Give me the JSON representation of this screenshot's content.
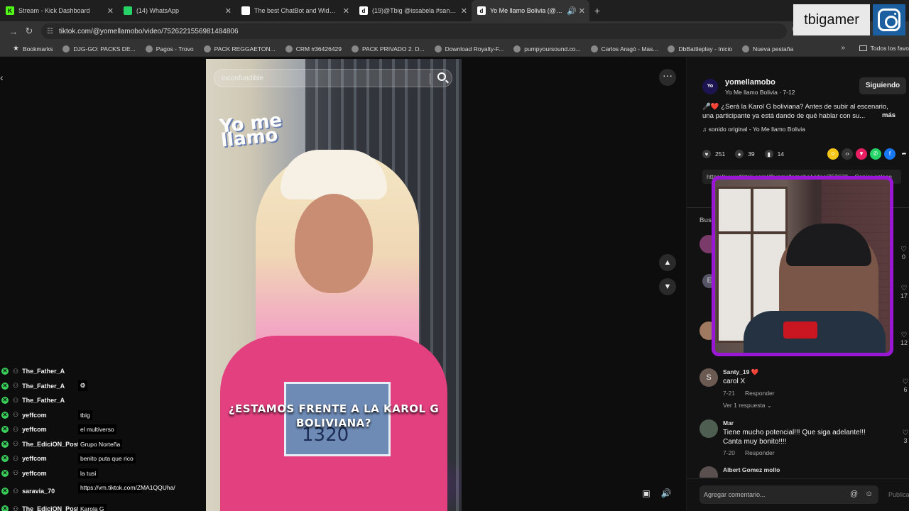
{
  "tabs": [
    {
      "title": "Stream - Kick Dashboard",
      "icon": "kick-icon",
      "color": "#53fc18",
      "glyph": "K",
      "active": false
    },
    {
      "title": "(14) WhatsApp",
      "icon": "whatsapp-icon",
      "color": "#25d366",
      "glyph": "",
      "active": false
    },
    {
      "title": "The best ChatBot and Widgets",
      "icon": "diamond-icon",
      "color": "#ffffff",
      "glyph": "",
      "active": false
    },
    {
      "title": "(19)@Tbig @issabela #santacru",
      "icon": "tiktok-icon",
      "color": "#ffffff",
      "glyph": "d",
      "active": false
    },
    {
      "title": "Yo Me llamo Bolivia (@yom",
      "icon": "tiktok-icon",
      "color": "#ffffff",
      "glyph": "d",
      "active": true
    }
  ],
  "address": {
    "url": "tiktok.com/@yomellamobo/video/7526221556981484806"
  },
  "bookmarks": [
    {
      "label": "Bookmarks",
      "icon": "star-icon"
    },
    {
      "label": "DJG-GO: PACKS DE...",
      "icon": "site-icon"
    },
    {
      "label": "Pagos - Trovo",
      "icon": "site-icon"
    },
    {
      "label": "PACK REGGAETON...",
      "icon": "site-icon"
    },
    {
      "label": "CRM #36426429",
      "icon": "site-icon"
    },
    {
      "label": "PACK PRIVADO 2. D...",
      "icon": "site-icon"
    },
    {
      "label": "Download Royalty-F...",
      "icon": "site-icon"
    },
    {
      "label": "pumpyoursound.co...",
      "icon": "site-icon"
    },
    {
      "label": "Carlos Aragó - Mas...",
      "icon": "site-icon"
    },
    {
      "label": "DbBattleplay - Inicio",
      "icon": "site-icon"
    },
    {
      "label": "Nueva pestaña",
      "icon": "site-icon"
    }
  ],
  "bookmarks_folder": "Todos los favo",
  "streamer": {
    "name": "tbigamer"
  },
  "video": {
    "search_placeholder": "inconfundible",
    "logo_text": "Yo me llamo",
    "caption": "¿ESTAMOS FRENTE A LA KAROL G BOLIVIANA?",
    "sign_number": "1320"
  },
  "chat": [
    {
      "user": "The_Father_A",
      "msg": ""
    },
    {
      "user": "The_Father_A",
      "msg": "❂"
    },
    {
      "user": "The_Father_A",
      "msg": ""
    },
    {
      "user": "yeffcom",
      "msg": "tbig"
    },
    {
      "user": "yeffcom",
      "msg": "el multiverso"
    },
    {
      "user": "The_EdiciON_Post",
      "msg": "Grupo Norteña"
    },
    {
      "user": "yeffcom",
      "msg": "benito puta que rico"
    },
    {
      "user": "yeffcom",
      "msg": "la tusi"
    },
    {
      "user": "saravia_70",
      "msg": "https://vm.tiktok.com/ZMA1QQUha/"
    },
    {
      "user": "The_EdiciON_Post",
      "msg": "Karola G"
    }
  ],
  "post": {
    "avatar_text": "Yo",
    "username": "yomellamobo",
    "subtitle": "Yo Me llamo Bolivia · 7-12",
    "follow_label": "Siguiendo",
    "description": "🎤❤️ ¿Será la Karol G boliviana? Antes de subir al escenario, una participante ya está dando de qué hablar con su...",
    "more_label": "más",
    "sound": "♫ sonido original - Yo Me llamo Bolivia",
    "likes": "251",
    "comments": "39",
    "saves": "14",
    "link_text": "https://www.tiktok.com/@yomellamobo/video/752622... Copiar enlace",
    "search_label": "Bus"
  },
  "comments_partial_likes": [
    "0",
    "17",
    "12"
  ],
  "comments": [
    {
      "avatar": "S",
      "user": "Santy_19 ❤️",
      "text": "carol X",
      "date": "7-21",
      "reply_label": "Responder",
      "likes": "6",
      "replies": "Ver 1 respuesta ⌄"
    },
    {
      "avatar": "",
      "user": "Mar",
      "text": "Tiene mucho potencial!!! Que siga adelante!!! Canta muy bonito!!!!",
      "date": "7-20",
      "reply_label": "Responder",
      "likes": "3",
      "replies": ""
    },
    {
      "avatar": "",
      "user": "Albert Gomez mollo",
      "text": "",
      "date": "",
      "reply_label": "",
      "likes": "",
      "replies": ""
    }
  ],
  "comment_input": {
    "placeholder": "Agregar comentario...",
    "publish": "Publica"
  }
}
